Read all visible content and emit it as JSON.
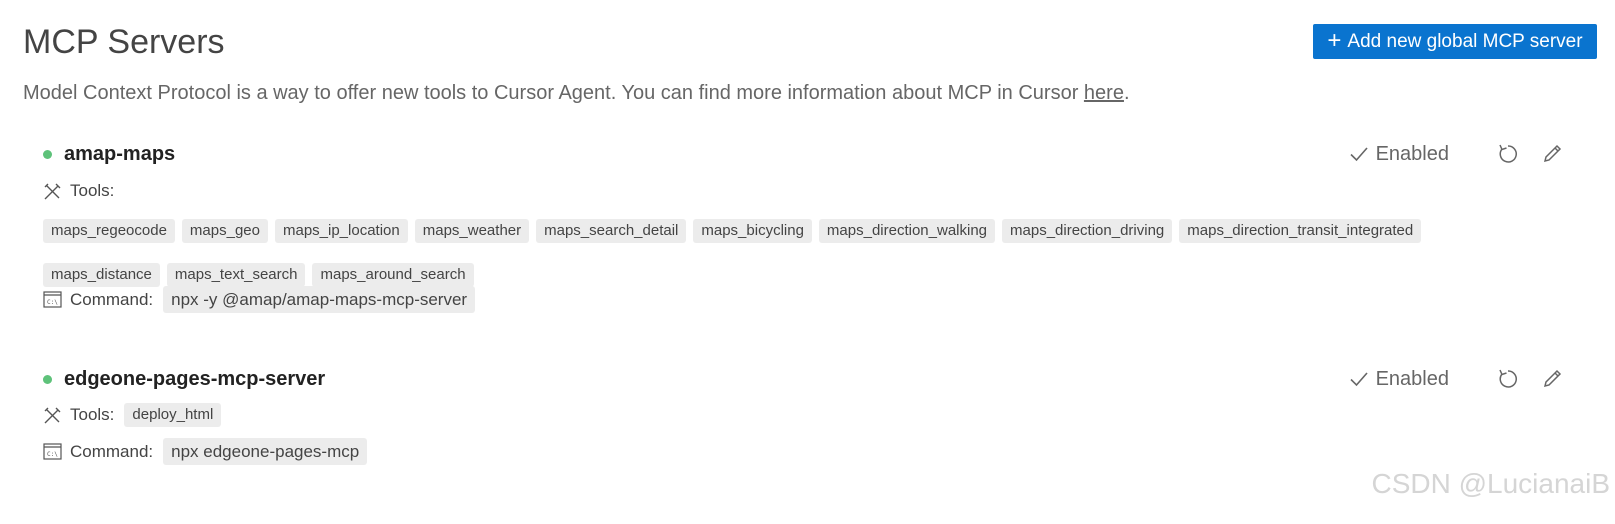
{
  "header": {
    "title": "MCP Servers",
    "add_button_label": "Add new global MCP server",
    "description_text": "Model Context Protocol is a way to offer new tools to Cursor Agent. You can find more information about MCP in Cursor ",
    "description_link": "here",
    "description_end": "."
  },
  "servers": [
    {
      "name": "amap-maps",
      "status_color": "#5ec27a",
      "enabled_label": "Enabled",
      "tools_label": "Tools:",
      "tools": [
        "maps_regeocode",
        "maps_geo",
        "maps_ip_location",
        "maps_weather",
        "maps_search_detail",
        "maps_bicycling",
        "maps_direction_walking",
        "maps_direction_driving",
        "maps_direction_transit_integrated",
        "maps_distance",
        "maps_text_search",
        "maps_around_search"
      ],
      "command_label": "Command:",
      "command": "npx -y @amap/amap-maps-mcp-server"
    },
    {
      "name": "edgeone-pages-mcp-server",
      "status_color": "#5ec27a",
      "enabled_label": "Enabled",
      "tools_label": "Tools:",
      "tools": [
        "deploy_html"
      ],
      "command_label": "Command:",
      "command": "npx edgeone-pages-mcp"
    }
  ],
  "watermark": "CSDN @LucianaiB",
  "colors": {
    "accent": "#0a74cf",
    "status_ok": "#5ec27a",
    "chip_bg": "#ececec"
  }
}
